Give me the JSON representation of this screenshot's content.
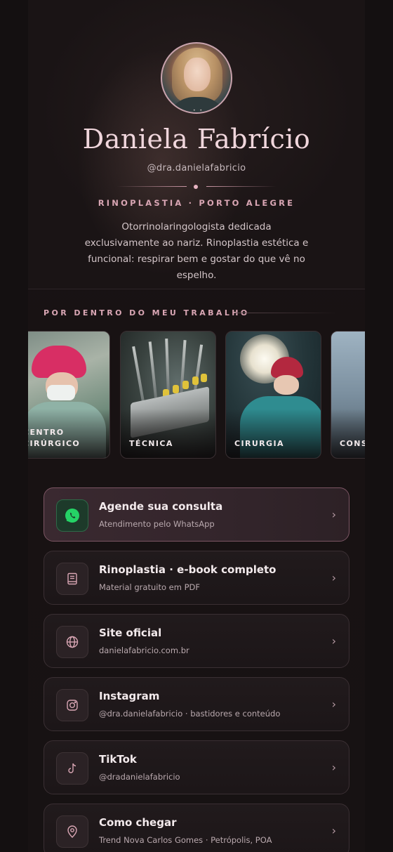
{
  "profile": {
    "name": "Daniela Fabrício",
    "handle": "@dra.danielafabricio",
    "specialty": "RINOPLASTIA · PORTO ALEGRE",
    "bio": "Otorrinolaringologista dedicada exclusivamente ao nariz. Rinoplastia estética e funcional: respirar bem e gostar do que vê no espelho."
  },
  "gallery": {
    "title": "POR DENTRO DO MEU TRABALHO",
    "cards": [
      {
        "label": "CENTRO\nCIRÚRGICO"
      },
      {
        "label": "TÉCNICA"
      },
      {
        "label": "CIRURGIA"
      },
      {
        "label": "CONS"
      }
    ]
  },
  "links": [
    {
      "title": "Agende sua consulta",
      "subtitle": "Atendimento pelo WhatsApp",
      "icon": "whatsapp-icon"
    },
    {
      "title": "Rinoplastia · e-book completo",
      "subtitle": "Material gratuito em PDF",
      "icon": "book-icon"
    },
    {
      "title": "Site oficial",
      "subtitle": "danielafabricio.com.br",
      "icon": "globe-icon"
    },
    {
      "title": "Instagram",
      "subtitle": "@dra.danielafabricio · bastidores e conteúdo",
      "icon": "instagram-icon"
    },
    {
      "title": "TikTok",
      "subtitle": "@dradanielafabricio",
      "icon": "tiktok-icon"
    },
    {
      "title": "Como chegar",
      "subtitle": "Trend Nova Carlos Gomes · Petrópolis, POA",
      "icon": "map-pin-icon"
    }
  ],
  "colors": {
    "background": "#141011",
    "accent": "#d9a6b4",
    "whatsapp": "#25d366"
  }
}
